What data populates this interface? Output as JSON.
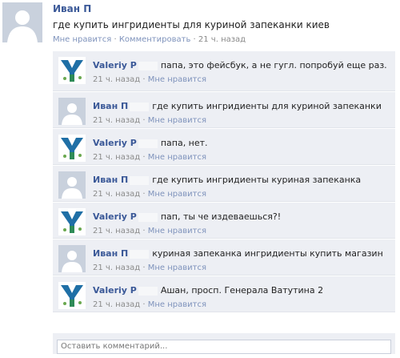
{
  "post": {
    "author": "Иван П",
    "text": "где купить ингридиенты для куриной запеканки киев",
    "like_label": "Мне нравится",
    "comment_label": "Комментировать",
    "time": "21 ч. назад",
    "separator": "·"
  },
  "comments": [
    {
      "author": "Valeriy P",
      "avatar": "logo-icon",
      "text": "папа, это фейсбук, а не гугл. попробуй еще раз.",
      "time": "21 ч. назад",
      "like_label": "Мне нравится"
    },
    {
      "author": "Иван П",
      "avatar": "person-icon",
      "text": "где купить ингридиенты для куриной запеканки",
      "time": "21 ч. назад",
      "like_label": "Мне нравится"
    },
    {
      "author": "Valeriy P",
      "avatar": "logo-icon",
      "text": "папа, нет.",
      "time": "21 ч. назад",
      "like_label": "Мне нравится"
    },
    {
      "author": "Иван П",
      "avatar": "person-icon",
      "text": "где купить ингридиенты куриная запеканка",
      "time": "21 ч. назад",
      "like_label": "Мне нравится"
    },
    {
      "author": "Valeriy P",
      "avatar": "logo-icon",
      "text": "пап, ты че издеваешься?!",
      "time": "21 ч. назад",
      "like_label": "Мне нравится"
    },
    {
      "author": "Иван П",
      "avatar": "person-icon",
      "text": "куриная запеканка ингридиенты купить магазин",
      "time": "21 ч. назад",
      "like_label": "Мне нравится"
    },
    {
      "author": "Valeriy P",
      "avatar": "logo-icon",
      "text": "Ашан, просп. Генерала Ватутина 2",
      "time": "21 ч. назад",
      "like_label": "Мне нравится"
    }
  ],
  "add_comment": {
    "placeholder": "Оставить комментарий..."
  },
  "colors": {
    "link": "#3b5998",
    "comment_bg": "#edeff4",
    "meta": "#8a8a8a"
  }
}
